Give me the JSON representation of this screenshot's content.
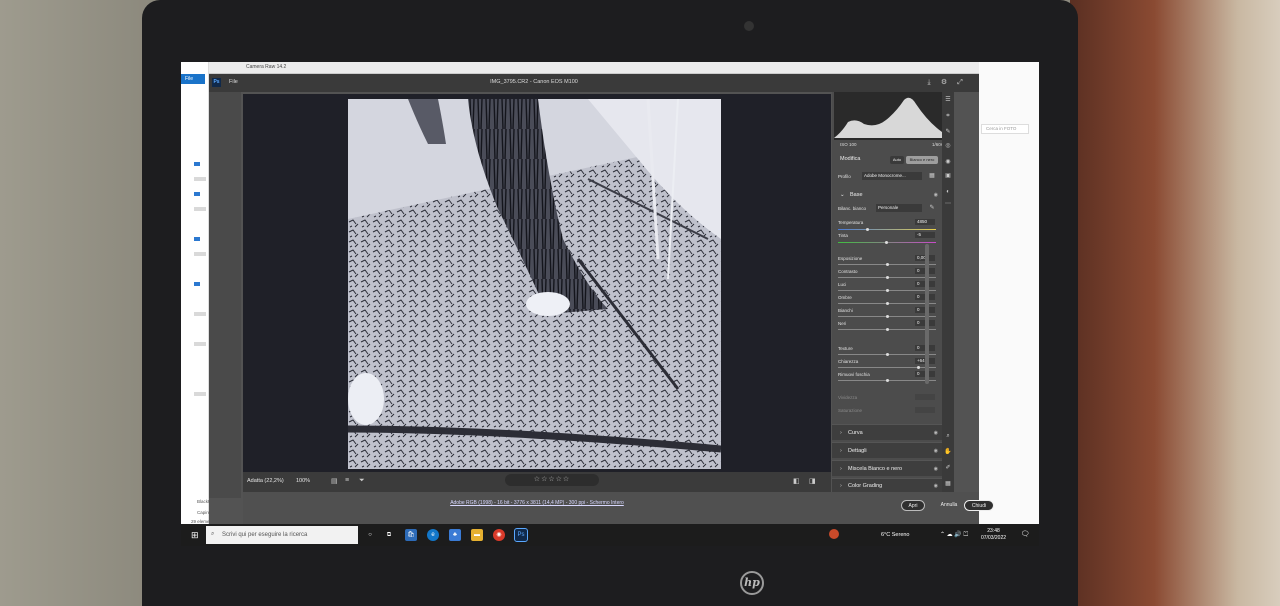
{
  "cameraraw": {
    "window_title": "Camera Raw 14.2",
    "menu_file": "File",
    "filename": "IMG_3795.CR2  -  Canon EOS M100",
    "ps_badge": "Ps"
  },
  "explorer": {
    "file_tab": "File",
    "search_placeholder": "Cerca in FOTO",
    "item_count": "29 elementi",
    "item_selected": "1 elem",
    "items": [
      "BlackFox NWD",
      "Capire i trattam"
    ]
  },
  "panel": {
    "iso": "ISO 100",
    "shutter": "1/60s",
    "section_title": "Modifica",
    "auto_label": "Auto",
    "bw_label": "Bianco e nero",
    "profile_label": "Profilo",
    "profile_value": "Adobe Monocrome...",
    "base_title": "Base",
    "wb_label": "Bilanc. bianco",
    "wb_value": "Personale",
    "temperature_label": "Temperatura",
    "temperature_value": "4850",
    "tint_label": "Tinta",
    "tint_value": "-5",
    "sliders": [
      {
        "label": "Esposizione",
        "value": "0,00",
        "pos": 0.5
      },
      {
        "label": "Contrasto",
        "value": "0",
        "pos": 0.5
      },
      {
        "label": "Luci",
        "value": "0",
        "pos": 0.5
      },
      {
        "label": "Ombre",
        "value": "0",
        "pos": 0.5
      },
      {
        "label": "Bianchi",
        "value": "0",
        "pos": 0.5
      },
      {
        "label": "Neri",
        "value": "0",
        "pos": 0.5
      }
    ],
    "sliders2": [
      {
        "label": "Texture",
        "value": "0",
        "pos": 0.5
      },
      {
        "label": "Chiarezza",
        "value": "+64",
        "pos": 0.82
      },
      {
        "label": "Rimuovi foschia",
        "value": "0",
        "pos": 0.5
      }
    ],
    "disabled": [
      "Vividezza",
      "Saturazione"
    ],
    "collapsed_sections": [
      "Curva",
      "Dettagli",
      "Miscela Bianco e nero",
      "Color Grading"
    ]
  },
  "bottom": {
    "zoom_fit": "Adatta (22,2%)",
    "zoom_100": "100%",
    "stars": "☆☆☆☆☆",
    "info_link": "Adobe RGB (1998) - 16 bit - 3776 x 3811 (14,4 MP) - 300 ppi - Schermo Intero",
    "open_button": "Apri",
    "cancel_button": "Annulla",
    "close_button": "Chiudi"
  },
  "taskbar": {
    "search_placeholder": "Scrivi qui per eseguire la ricerca",
    "weather": "6°C Sereno",
    "time": "23:48",
    "date": "07/03/2022"
  },
  "colors": {
    "accent": "#1a73c9",
    "ps_blue": "#10294a",
    "panel_bg": "#4c4c4c"
  }
}
